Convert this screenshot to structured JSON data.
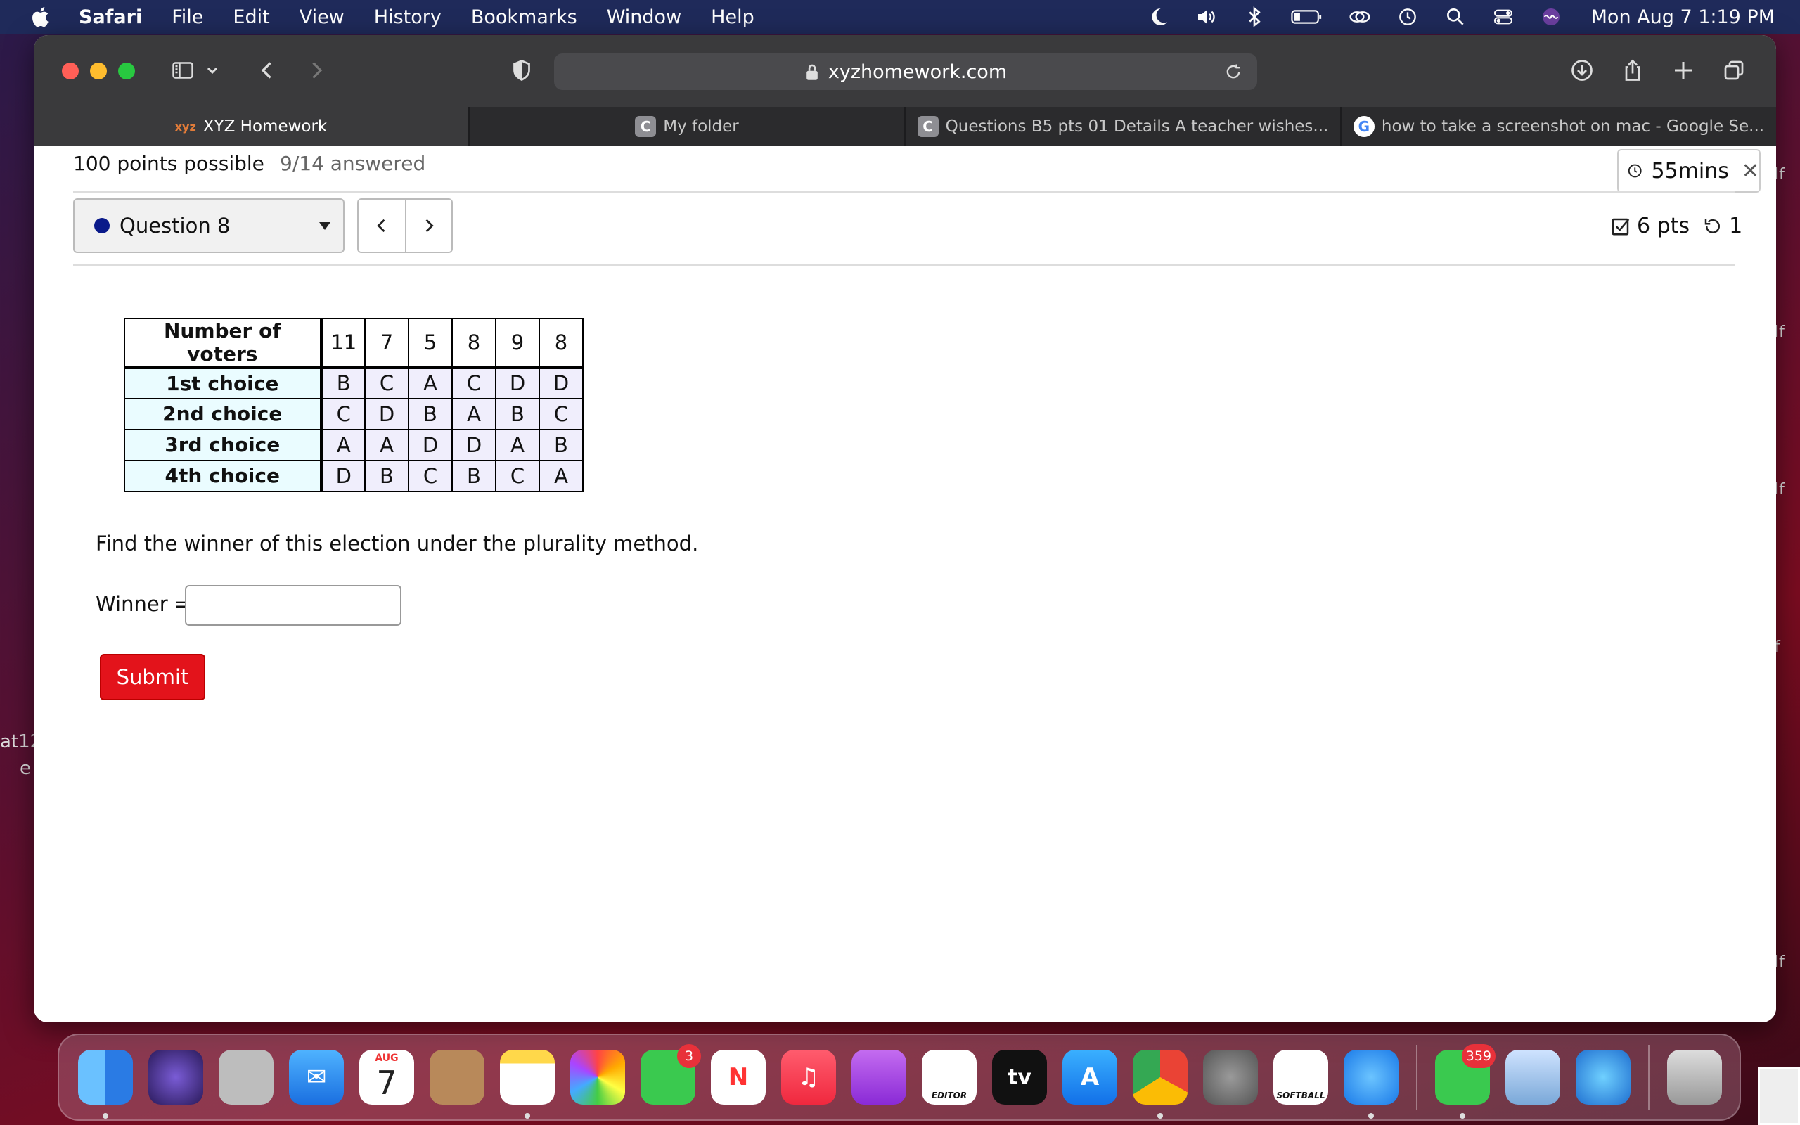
{
  "menubar": {
    "app": "Safari",
    "items": [
      "File",
      "Edit",
      "View",
      "History",
      "Bookmarks",
      "Window",
      "Help"
    ],
    "clock": "Mon Aug 7  1:19 PM"
  },
  "desktop": {
    "fragment_line1": "at12",
    "fragment_line2": "e",
    "right_fragment": "lf",
    "right_fragment_short": "f"
  },
  "browser": {
    "url": "xyzhomework.com",
    "tabs": [
      {
        "label": "XYZ Homework",
        "favicon": "xyz"
      },
      {
        "label": "My folder",
        "favicon": "C"
      },
      {
        "label": "Questions B5 pts 01 Details A teacher wishes...",
        "favicon": "C"
      },
      {
        "label": "how to take a screenshot on mac - Google Se...",
        "favicon": "G"
      }
    ]
  },
  "quiz": {
    "points_possible": "100 points possible",
    "answered": "9/14 answered",
    "timer": "55mins",
    "question_label": "Question 8",
    "pts": "6 pts",
    "attempts": "1",
    "prompt": "Find the winner of this election under the plurality method.",
    "winner_label": "Winner =",
    "winner_value": "",
    "submit_label": "Submit"
  },
  "table": {
    "header_label": "Number of voters",
    "voters": [
      "11",
      "7",
      "5",
      "8",
      "9",
      "8"
    ],
    "rows": [
      {
        "label": "1st choice",
        "values": [
          "B",
          "C",
          "A",
          "C",
          "D",
          "D"
        ]
      },
      {
        "label": "2nd choice",
        "values": [
          "C",
          "D",
          "B",
          "A",
          "B",
          "C"
        ]
      },
      {
        "label": "3rd choice",
        "values": [
          "A",
          "A",
          "D",
          "D",
          "A",
          "B"
        ]
      },
      {
        "label": "4th choice",
        "values": [
          "D",
          "B",
          "C",
          "B",
          "C",
          "A"
        ]
      }
    ]
  },
  "dock": {
    "calendar_month": "AUG",
    "calendar_day": "7",
    "facetime_badge": "3",
    "messages_badge": "359",
    "tv_label": "tv",
    "editor_label": "EDITOR",
    "softball_label": "SOFTBALL"
  }
}
